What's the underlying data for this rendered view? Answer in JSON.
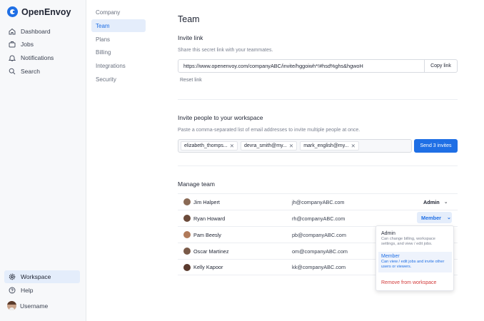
{
  "app": {
    "name": "OpenEnvoy"
  },
  "sidebar": {
    "items": [
      {
        "label": "Dashboard",
        "icon": "home-icon"
      },
      {
        "label": "Jobs",
        "icon": "briefcase-icon"
      },
      {
        "label": "Notifications",
        "icon": "bell-icon"
      },
      {
        "label": "Search",
        "icon": "search-icon"
      }
    ],
    "bottom": [
      {
        "label": "Workspace",
        "icon": "gear-icon",
        "active": true
      },
      {
        "label": "Help",
        "icon": "help-icon"
      }
    ],
    "user": {
      "label": "Username"
    }
  },
  "subnav": {
    "items": [
      "Company",
      "Team",
      "Plans",
      "Billing",
      "Integrations",
      "Security"
    ],
    "active": "Team"
  },
  "page": {
    "title": "Team"
  },
  "invite_link": {
    "heading": "Invite link",
    "description": "Share this secret link with your teammates.",
    "url": "https://www.openenvoy.com/companyABC/invite/hggoiwh*!#hsd%ghs&hgwoH",
    "copy_label": "Copy link",
    "reset_label": "Reset link"
  },
  "invite_people": {
    "heading": "Invite people to your workspace",
    "description": "Paste a comma-separated list of email addresses to invite multiple people at once.",
    "chips": [
      "elizabeth_thomps...",
      "devra_smith@my...",
      "mark_english@my..."
    ],
    "send_label": "Send 3 invites"
  },
  "team": {
    "heading": "Manage team",
    "members": [
      {
        "name": "Jim Halpert",
        "email": "jh@companyABC.com",
        "role": "Admin"
      },
      {
        "name": "Ryan Howard",
        "email": "rh@companyABC.com",
        "role": "Member"
      },
      {
        "name": "Pam Beesly",
        "email": "pb@companyABC.com",
        "role": ""
      },
      {
        "name": "Oscar Martinez",
        "email": "om@companyABC.com",
        "role": ""
      },
      {
        "name": "Kelly Kapoor",
        "email": "kk@companyABC.com",
        "role": ""
      }
    ]
  },
  "role_menu": {
    "options": [
      {
        "title": "Admin",
        "desc": "Can change billing, workspace settings, and view / edit jobs."
      },
      {
        "title": "Member",
        "desc": "Can view / edit jobs and invite other users or viewers.",
        "selected": true
      },
      {
        "title": "Remove from workspace",
        "desc": ""
      }
    ]
  },
  "colors": {
    "accent": "#1f6fe5",
    "danger": "#d23b3b",
    "sidebar_bg": "#f7f8fa"
  }
}
